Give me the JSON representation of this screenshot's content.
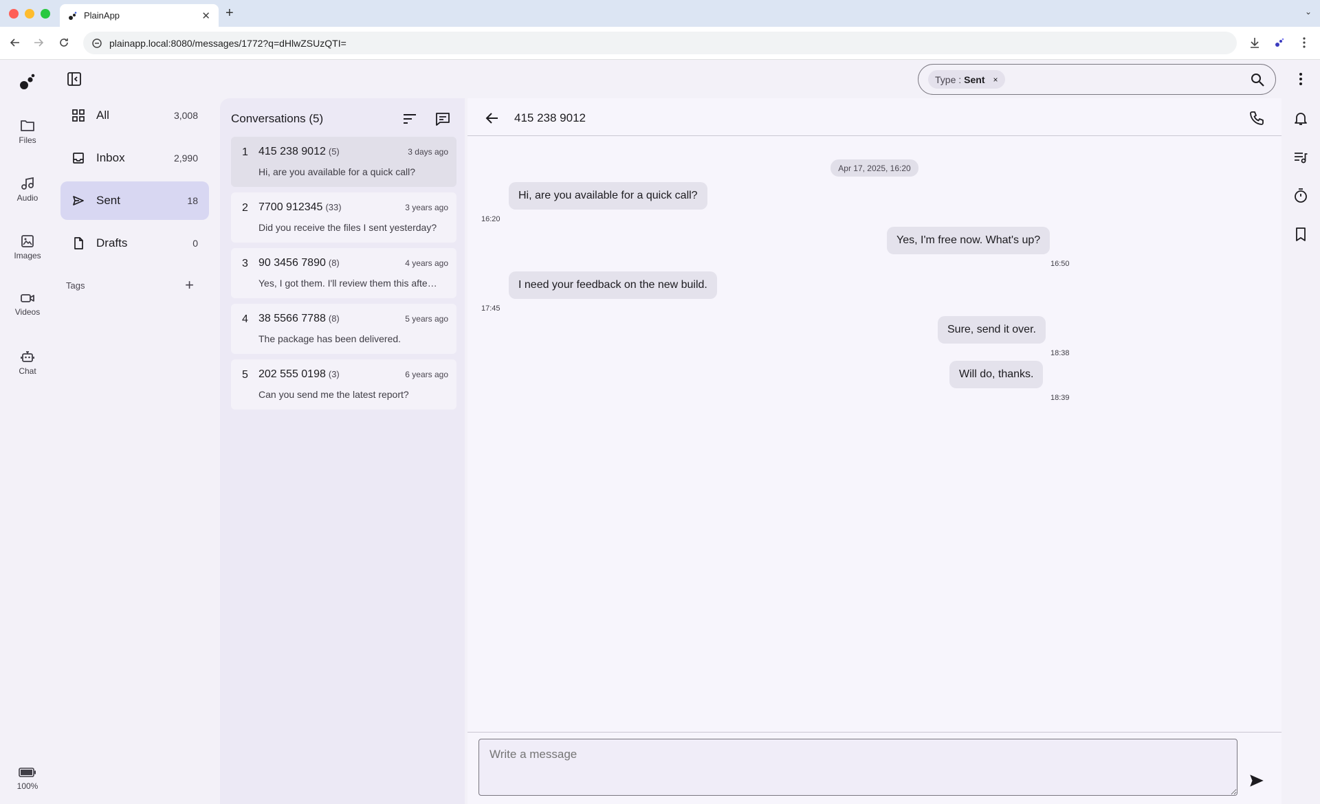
{
  "browser": {
    "tab_title": "PlainApp",
    "url": "plainapp.local:8080/messages/1772?q=dHlwZSUzQTI="
  },
  "rail": {
    "items": [
      {
        "label": "Files",
        "icon": "folder-icon"
      },
      {
        "label": "Audio",
        "icon": "music-note-icon"
      },
      {
        "label": "Images",
        "icon": "image-icon"
      },
      {
        "label": "Videos",
        "icon": "video-camera-icon"
      },
      {
        "label": "Chat",
        "icon": "robot-icon"
      }
    ],
    "battery": "100%"
  },
  "sidebar": {
    "items": [
      {
        "label": "All",
        "count": "3,008",
        "icon": "grid-icon"
      },
      {
        "label": "Inbox",
        "count": "2,990",
        "icon": "inbox-icon"
      },
      {
        "label": "Sent",
        "count": "18",
        "icon": "send-icon",
        "active": true
      },
      {
        "label": "Drafts",
        "count": "0",
        "icon": "draft-icon"
      }
    ],
    "tags_label": "Tags"
  },
  "search": {
    "chip_key": "Type :",
    "chip_value": "Sent",
    "chip_remove": "×"
  },
  "conversations": {
    "title": "Conversations (5)",
    "items": [
      {
        "num": "1",
        "name": "415 238 9012",
        "count": "(5)",
        "time": "3 days ago",
        "preview": "Hi, are you available for a quick call?"
      },
      {
        "num": "2",
        "name": "7700 912345",
        "count": "(33)",
        "time": "3 years ago",
        "preview": "Did you receive the files I sent yesterday?"
      },
      {
        "num": "3",
        "name": "90 3456 7890",
        "count": "(8)",
        "time": "4 years ago",
        "preview": "Yes, I got them. I'll review them this afte…"
      },
      {
        "num": "4",
        "name": "38 5566 7788",
        "count": "(8)",
        "time": "5 years ago",
        "preview": "The package has been delivered."
      },
      {
        "num": "5",
        "name": "202 555 0198",
        "count": "(3)",
        "time": "6 years ago",
        "preview": "Can you send me the latest report?"
      }
    ]
  },
  "chat": {
    "title": "415 238 9012",
    "date": "Apr 17, 2025, 16:20",
    "messages": [
      {
        "text": "Hi, are you available for a quick call?",
        "time": "16:20",
        "side": "in"
      },
      {
        "text": "Yes, I'm free now. What's up?",
        "time": "16:50",
        "side": "out"
      },
      {
        "text": "I need your feedback on the new build.",
        "time": "17:45",
        "side": "in"
      },
      {
        "text": "Sure, send it over.",
        "time": "18:38",
        "side": "out"
      },
      {
        "text": "Will do, thanks.",
        "time": "18:39",
        "side": "out"
      }
    ],
    "composer_placeholder": "Write a message"
  },
  "colors": {
    "accent": "#d8d7f2",
    "bubble": "#e4e2ec",
    "background": "#f3f1f8"
  }
}
